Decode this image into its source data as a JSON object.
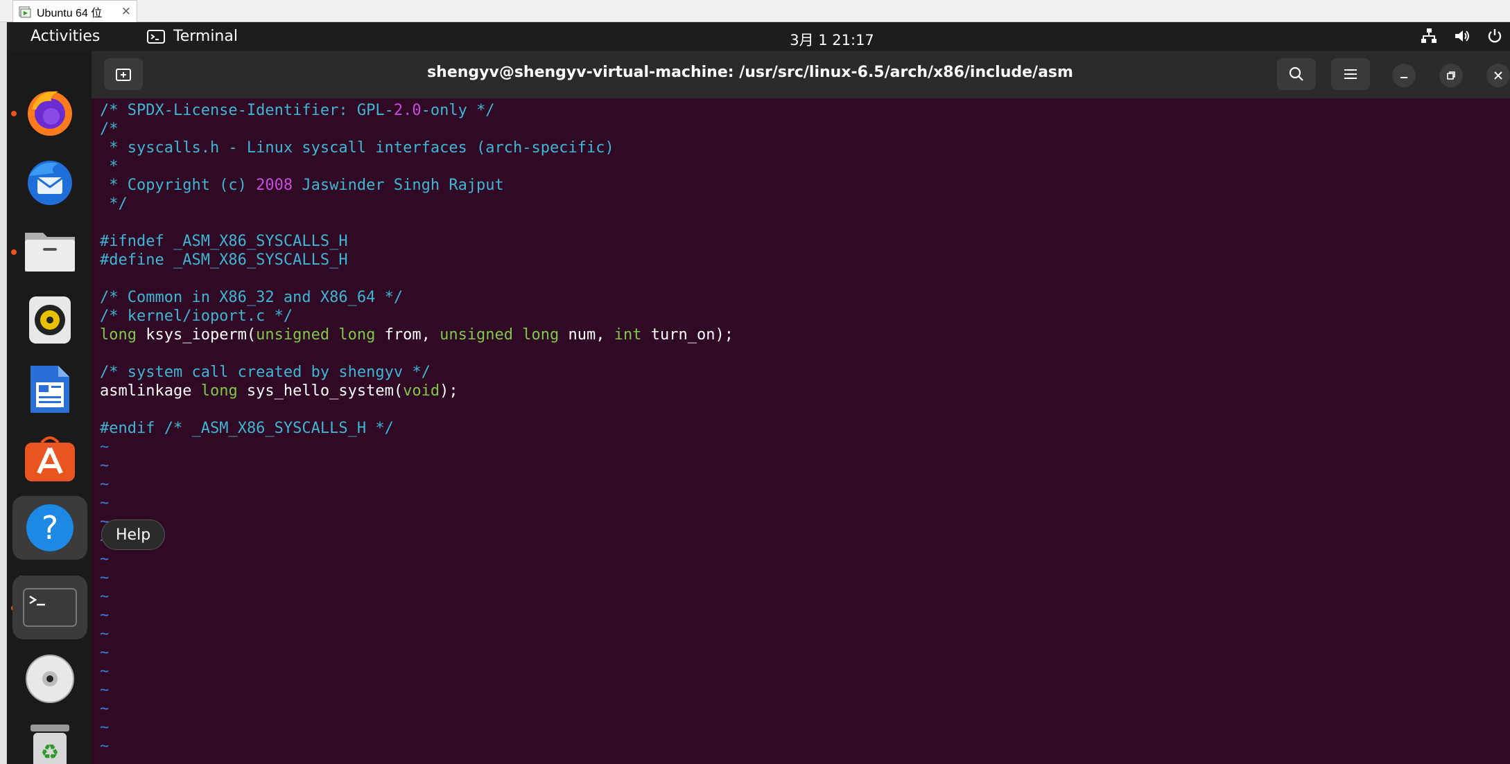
{
  "host": {
    "tab_label": "Ubuntu 64 位",
    "tab_close": "✕"
  },
  "topbar": {
    "activities": "Activities",
    "app_name": "Terminal",
    "clock": "3月 1  21:17"
  },
  "dock": {
    "items": [
      "firefox",
      "thunderbird",
      "files",
      "rhythmbox",
      "libreoffice-writer",
      "app-center",
      "help",
      "terminal",
      "dvd",
      "trash"
    ],
    "tooltip": "Help"
  },
  "terminal": {
    "title": "shengyv@shengyv-virtual-machine: /usr/src/linux-6.5/arch/x86/include/asm",
    "lines": [
      [
        {
          "t": "/* SPDX-License-Identifier: GPL-",
          "c": "c-com"
        },
        {
          "t": "2.0",
          "c": "c-num"
        },
        {
          "t": "-only */",
          "c": "c-com"
        }
      ],
      [
        {
          "t": "/*",
          "c": "c-com"
        }
      ],
      [
        {
          "t": " * syscalls.h - Linux syscall interfaces (arch-specific)",
          "c": "c-com"
        }
      ],
      [
        {
          "t": " *",
          "c": "c-com"
        }
      ],
      [
        {
          "t": " * Copyright (c) ",
          "c": "c-com"
        },
        {
          "t": "2008",
          "c": "c-num"
        },
        {
          "t": " Jaswinder Singh Rajput",
          "c": "c-com"
        }
      ],
      [
        {
          "t": " */",
          "c": "c-com"
        }
      ],
      [],
      [
        {
          "t": "#ifndef _ASM_X86_SYSCALLS_H",
          "c": "c-pre"
        }
      ],
      [
        {
          "t": "#define _ASM_X86_SYSCALLS_H",
          "c": "c-pre"
        }
      ],
      [],
      [
        {
          "t": "/* Common in X86_32 and X86_64 */",
          "c": "c-com"
        }
      ],
      [
        {
          "t": "/* kernel/ioport.c */",
          "c": "c-com"
        }
      ],
      [
        {
          "t": "long",
          "c": "c-typ"
        },
        {
          "t": " ksys_ioperm(",
          "c": ""
        },
        {
          "t": "unsigned long",
          "c": "c-typ"
        },
        {
          "t": " from, ",
          "c": ""
        },
        {
          "t": "unsigned long",
          "c": "c-typ"
        },
        {
          "t": " num, ",
          "c": ""
        },
        {
          "t": "int",
          "c": "c-typ"
        },
        {
          "t": " turn_on);",
          "c": ""
        }
      ],
      [],
      [
        {
          "t": "/* system call created by shengyv */",
          "c": "c-com"
        }
      ],
      [
        {
          "t": "asmlinkage ",
          "c": ""
        },
        {
          "t": "long",
          "c": "c-typ"
        },
        {
          "t": " sys_hello_system(",
          "c": ""
        },
        {
          "t": "void",
          "c": "c-typ"
        },
        {
          "t": ");",
          "c": ""
        }
      ],
      [],
      [
        {
          "t": "#endif",
          "c": "c-pre"
        },
        {
          "t": " ",
          "c": ""
        },
        {
          "t": "/* _ASM_X86_SYSCALLS_H */",
          "c": "c-com"
        }
      ],
      [
        {
          "t": "~",
          "c": "c-tilde"
        }
      ],
      [
        {
          "t": "~",
          "c": "c-tilde"
        }
      ],
      [
        {
          "t": "~",
          "c": "c-tilde"
        }
      ],
      [
        {
          "t": "~",
          "c": "c-tilde"
        }
      ],
      [
        {
          "t": "~",
          "c": "c-tilde"
        }
      ],
      [
        {
          "t": "~",
          "c": "c-tilde"
        }
      ],
      [
        {
          "t": "~",
          "c": "c-tilde"
        }
      ],
      [
        {
          "t": "~",
          "c": "c-tilde"
        }
      ],
      [
        {
          "t": "~",
          "c": "c-tilde"
        }
      ],
      [
        {
          "t": "~",
          "c": "c-tilde"
        }
      ],
      [
        {
          "t": "~",
          "c": "c-tilde"
        }
      ],
      [
        {
          "t": "~",
          "c": "c-tilde"
        }
      ],
      [
        {
          "t": "~",
          "c": "c-tilde"
        }
      ],
      [
        {
          "t": "~",
          "c": "c-tilde"
        }
      ],
      [
        {
          "t": "~",
          "c": "c-tilde"
        }
      ],
      [
        {
          "t": "~",
          "c": "c-tilde"
        }
      ],
      [
        {
          "t": "~",
          "c": "c-tilde"
        }
      ],
      [
        {
          "t": "~",
          "c": "c-tilde"
        }
      ]
    ]
  },
  "colors": {
    "terminal_bg": "#300a24",
    "comment": "#3fb6d4",
    "number": "#c94ce0",
    "type": "#7ec84a",
    "tilde": "#3f7fd8",
    "accent": "#e95420"
  }
}
